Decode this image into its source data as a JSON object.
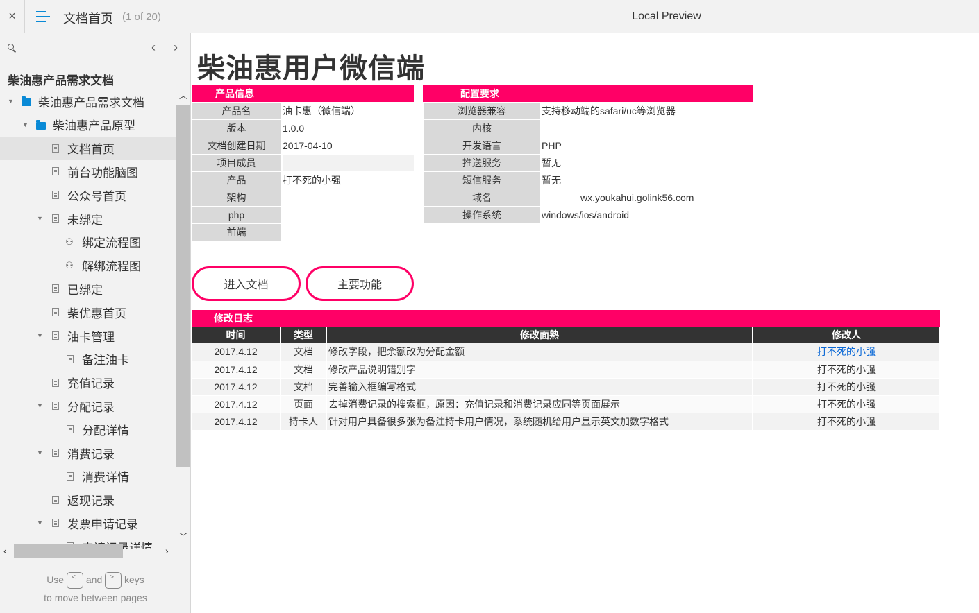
{
  "topbar": {
    "close": "×",
    "page_title": "文档首页",
    "page_count": "(1 of 20)",
    "preview_label": "Local Preview"
  },
  "sidebar": {
    "nav_prev": "‹",
    "nav_next": "›",
    "project_title": "柴油惠产品需求文档",
    "tree": [
      {
        "label": "柴油惠产品需求文档",
        "kind": "folder",
        "level": 0,
        "expanded": true
      },
      {
        "label": "柴油惠产品原型",
        "kind": "folder",
        "level": 1,
        "expanded": true
      },
      {
        "label": "文档首页",
        "kind": "page",
        "level": 2,
        "selected": true
      },
      {
        "label": "前台功能脑图",
        "kind": "page",
        "level": 2
      },
      {
        "label": "公众号首页",
        "kind": "page",
        "level": 2
      },
      {
        "label": "未绑定",
        "kind": "page",
        "level": 2,
        "expanded": true
      },
      {
        "label": "绑定流程图",
        "kind": "flow",
        "level": 3
      },
      {
        "label": "解绑流程图",
        "kind": "flow",
        "level": 3
      },
      {
        "label": "已绑定",
        "kind": "page",
        "level": 2
      },
      {
        "label": "柴优惠首页",
        "kind": "page",
        "level": 2
      },
      {
        "label": "油卡管理",
        "kind": "page",
        "level": 2,
        "expanded": true
      },
      {
        "label": "备注油卡",
        "kind": "page",
        "level": 3
      },
      {
        "label": "充值记录",
        "kind": "page",
        "level": 2
      },
      {
        "label": "分配记录",
        "kind": "page",
        "level": 2,
        "expanded": true
      },
      {
        "label": "分配详情",
        "kind": "page",
        "level": 3
      },
      {
        "label": "消费记录",
        "kind": "page",
        "level": 2,
        "expanded": true
      },
      {
        "label": "消费详情",
        "kind": "page",
        "level": 3
      },
      {
        "label": "返现记录",
        "kind": "page",
        "level": 2
      },
      {
        "label": "发票申请记录",
        "kind": "page",
        "level": 2,
        "expanded": true
      },
      {
        "label": "申请记录详情",
        "kind": "page",
        "level": 3
      }
    ],
    "keys_hint": {
      "use": "Use",
      "and": "and",
      "keys": "keys",
      "line2": "to move between pages",
      "key_prev": "<",
      "key_next": ">"
    }
  },
  "doc": {
    "title": "柴油惠用户微信端",
    "product_info": {
      "header": "产品信息",
      "rows": [
        {
          "label": "产品名",
          "value": "油卡惠（微信端）"
        },
        {
          "label": "版本",
          "value": "1.0.0"
        },
        {
          "label": "文档创建日期",
          "value": "2017-04-10"
        },
        {
          "label": "项目成员",
          "value": ""
        },
        {
          "label": "产品",
          "value": "打不死的小强"
        },
        {
          "label": "架构",
          "value": ""
        },
        {
          "label": "php",
          "value": ""
        },
        {
          "label": "前端",
          "value": ""
        }
      ]
    },
    "config": {
      "header": "配置要求",
      "rows": [
        {
          "label": "浏览器兼容",
          "value": "支持移动端的safari/uc等浏览器"
        },
        {
          "label": "内核",
          "value": ""
        },
        {
          "label": "开发语言",
          "value": "PHP"
        },
        {
          "label": "推送服务",
          "value": "暂无"
        },
        {
          "label": "短信服务",
          "value": "暂无"
        },
        {
          "label": "域名",
          "value": "wx.youkahui.golink56.com"
        },
        {
          "label": "操作系统",
          "value": "windows/ios/android"
        }
      ]
    },
    "buttons": {
      "enter_doc": "进入文档",
      "main_features": "主要功能"
    },
    "changelog": {
      "header": "修改日志",
      "columns": [
        "时间",
        "类型",
        "修改面熟",
        "修改人"
      ],
      "rows": [
        {
          "time": "2017.4.12",
          "type": "文档",
          "desc": "修改字段，把余额改为分配金额",
          "author": "打不死的小强",
          "author_link": true
        },
        {
          "time": "2017.4.12",
          "type": "文档",
          "desc": "修改产品说明错别字",
          "author": "打不死的小强"
        },
        {
          "time": "2017.4.12",
          "type": "文档",
          "desc": "完善输入框编写格式",
          "author": "打不死的小强"
        },
        {
          "time": "2017.4.12",
          "type": "页面",
          "desc": "去掉消费记录的搜索框，原因：充值记录和消费记录应同等页面展示",
          "author": "打不死的小强"
        },
        {
          "time": "2017.4.12",
          "type": "持卡人",
          "desc": "针对用户具备很多张为备注持卡用户情况，系统随机给用户显示英文加数字格式",
          "author": "打不死的小强"
        }
      ]
    }
  }
}
